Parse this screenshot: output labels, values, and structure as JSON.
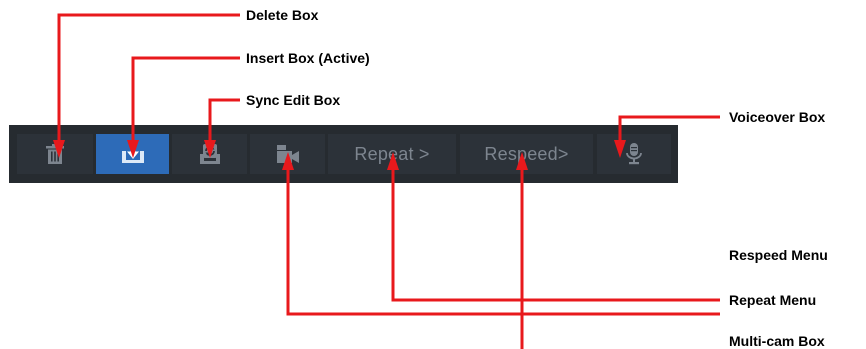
{
  "toolbar": {
    "buttons": {
      "delete": {
        "icon": "trash-icon"
      },
      "insert": {
        "icon": "insert-down-arrow-icon",
        "active": true
      },
      "sync_edit": {
        "icon": "sync-edit-icon"
      },
      "multicam": {
        "icon": "camera-icon"
      },
      "repeat": {
        "label": "Repeat >"
      },
      "respeed": {
        "label": "Respeed>"
      },
      "voiceover": {
        "icon": "microphone-icon"
      }
    },
    "colors": {
      "bar_background": "#262b30",
      "button_background": "#2c3239",
      "active_button": "#2d6bb8",
      "icon_color": "#7d858f"
    }
  },
  "callouts": {
    "delete": "Delete Box",
    "insert": "Insert Box (Active)",
    "sync_edit": "Sync Edit Box",
    "voiceover": "Voiceover Box",
    "respeed": "Respeed Menu",
    "repeat": "Repeat Menu",
    "multicam": "Multi-cam Box"
  },
  "annotation_color": "#e8191c"
}
